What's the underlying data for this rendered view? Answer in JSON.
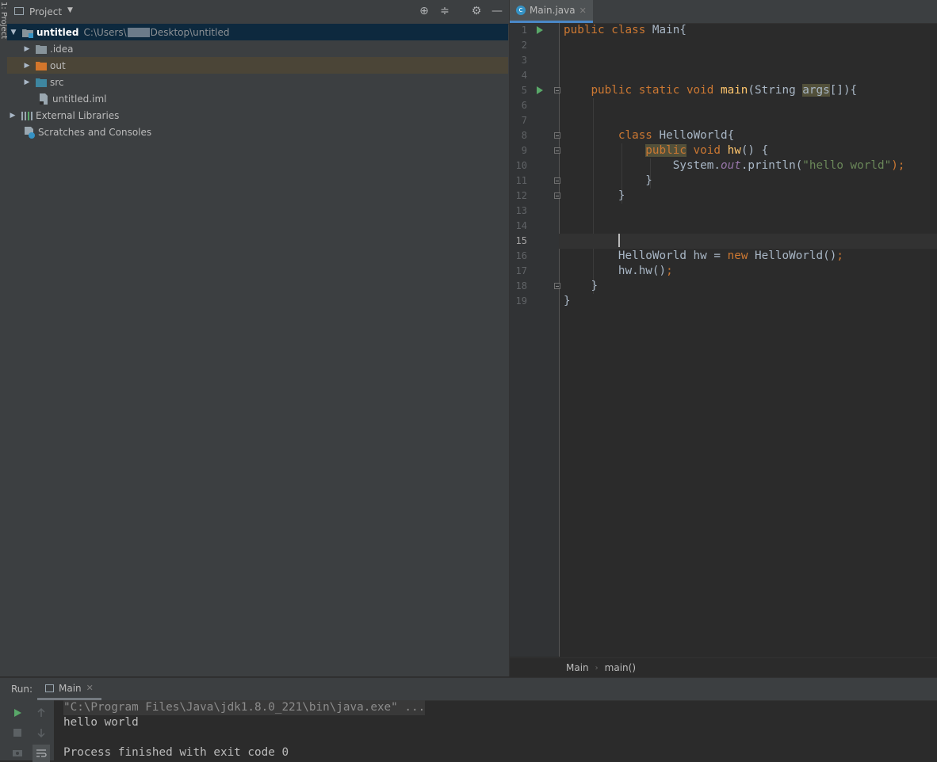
{
  "stripe": {
    "label": "1: Project"
  },
  "project": {
    "title": "Project",
    "root": {
      "name": "untitled",
      "path_prefix": "C:\\Users\\",
      "path_suffix": "Desktop\\untitled"
    },
    "items": [
      {
        "label": ".idea",
        "kind": "folder"
      },
      {
        "label": "out",
        "kind": "folder-orange"
      },
      {
        "label": "src",
        "kind": "folder-blue"
      },
      {
        "label": "untitled.iml",
        "kind": "file"
      },
      {
        "label": "External Libraries",
        "kind": "libraries"
      },
      {
        "label": "Scratches and Consoles",
        "kind": "scratches"
      }
    ]
  },
  "editor": {
    "tab": {
      "label": "Main.java"
    },
    "line_numbers": [
      "1",
      "2",
      "3",
      "4",
      "5",
      "6",
      "7",
      "8",
      "9",
      "10",
      "11",
      "12",
      "13",
      "14",
      "15",
      "16",
      "17",
      "18",
      "19"
    ],
    "code": {
      "l1_public": "public",
      "l1_class": "class",
      "l1_rest": " Main{",
      "l5_mods": "public static void",
      "l5_main": "main",
      "l5_open": "(String ",
      "l5_args": "args",
      "l5_close": "[]){",
      "l8_class": "class",
      "l8_rest": " HelloWorld{",
      "l9_public": "public",
      "l9_void": " void ",
      "l9_hw": "hw",
      "l9_rest": "() {",
      "l10_sys": "System.",
      "l10_out": "out",
      "l10_println": ".println(",
      "l10_str": "\"hello world\"",
      "l10_end": ");",
      "l11": "}",
      "l12": "}",
      "l16_decl": "HelloWorld hw = ",
      "l16_new": "new",
      "l16_rest": " HelloWorld()",
      "l16_semi": ";",
      "l17_call": "hw.hw()",
      "l17_semi": ";",
      "l18": "}",
      "l19": "}"
    },
    "breadcrumbs": [
      "Main",
      "main()"
    ]
  },
  "run": {
    "label": "Run:",
    "tab": "Main",
    "console": [
      "\"C:\\Program Files\\Java\\jdk1.8.0_221\\bin\\java.exe\" ...",
      "hello world",
      "",
      "Process finished with exit code 0"
    ]
  }
}
